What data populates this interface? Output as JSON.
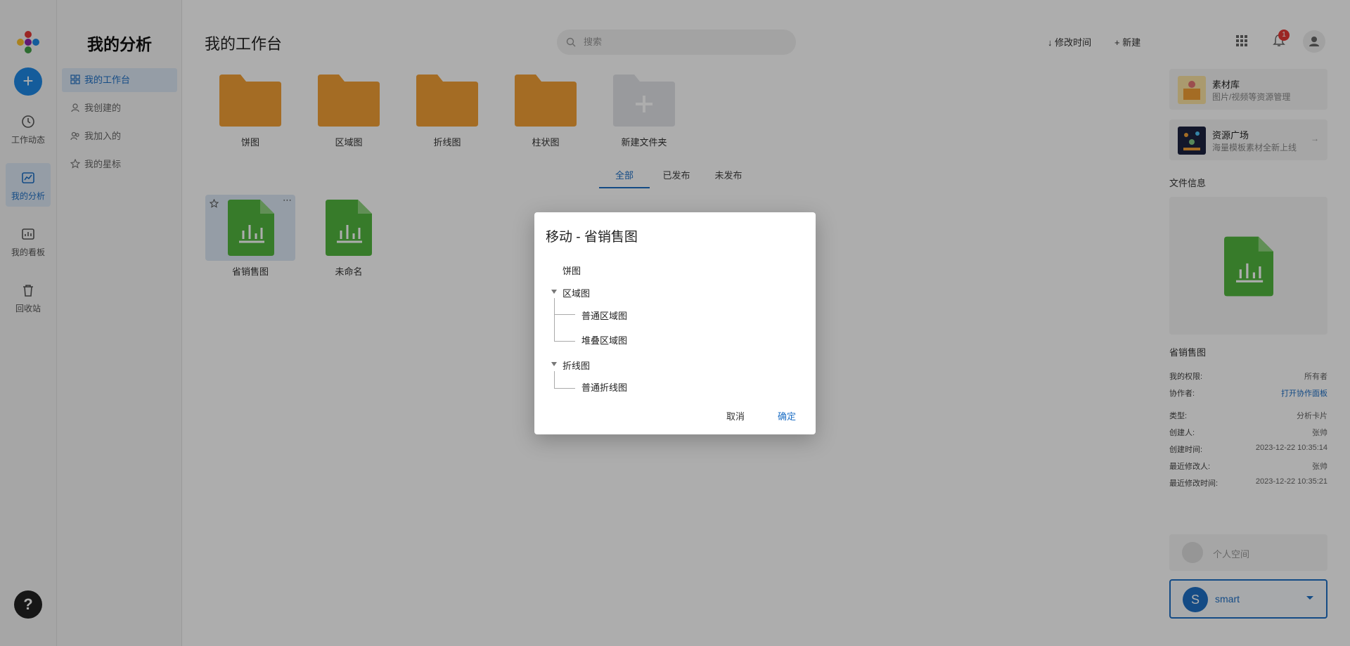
{
  "sidebar": {
    "add_label": "+",
    "items": [
      {
        "label": "工作动态",
        "icon": "clock-icon"
      },
      {
        "label": "我的分析",
        "icon": "analysis-icon"
      },
      {
        "label": "我的看板",
        "icon": "dashboard-icon"
      },
      {
        "label": "回收站",
        "icon": "trash-icon"
      }
    ],
    "help_label": "?"
  },
  "subnav": {
    "title": "我的分析",
    "items": [
      {
        "label": "我的工作台",
        "icon": "grid-icon"
      },
      {
        "label": "我创建的",
        "icon": "user-icon"
      },
      {
        "label": "我加入的",
        "icon": "users-icon"
      },
      {
        "label": "我的星标",
        "icon": "star-icon"
      }
    ]
  },
  "header": {
    "title": "我的工作台",
    "search_placeholder": "搜索",
    "sort_label": "修改时间",
    "new_label": "新建",
    "notification_count": "1"
  },
  "folders": [
    {
      "label": "饼图"
    },
    {
      "label": "区域图"
    },
    {
      "label": "折线图"
    },
    {
      "label": "柱状图"
    },
    {
      "label": "新建文件夹"
    }
  ],
  "tabs": [
    {
      "label": "全部"
    },
    {
      "label": "已发布"
    },
    {
      "label": "未发布"
    }
  ],
  "files": [
    {
      "label": "省销售图"
    },
    {
      "label": "未命名"
    }
  ],
  "right_panel": {
    "library": {
      "title": "素材库",
      "subtitle": "图片/视频等资源管理"
    },
    "plaza": {
      "title": "资源广场",
      "subtitle": "海量模板素材全新上线"
    },
    "file_info_title": "文件信息",
    "file_name": "省销售图",
    "rows": [
      {
        "k": "我的权限:",
        "v": "所有者"
      },
      {
        "k": "协作者:",
        "v": "打开协作面板"
      },
      {
        "k": "类型:",
        "v": "分析卡片"
      },
      {
        "k": "创建人:",
        "v": "张帅"
      },
      {
        "k": "创建时间:",
        "v": "2023-12-22 10:35:14"
      },
      {
        "k": "最近修改人:",
        "v": "张帅"
      },
      {
        "k": "最近修改时间:",
        "v": "2023-12-22 10:35:21"
      }
    ],
    "personal_space": "个人空间",
    "user": {
      "initial": "S",
      "name": "smart"
    }
  },
  "dialog": {
    "title": "移动 - 省销售图",
    "tree": [
      {
        "label": "饼图"
      },
      {
        "label": "区域图",
        "children": [
          {
            "label": "普通区域图"
          },
          {
            "label": "堆叠区域图"
          }
        ]
      },
      {
        "label": "折线图",
        "children": [
          {
            "label": "普通折线图"
          }
        ]
      }
    ],
    "cancel_label": "取消",
    "ok_label": "确定"
  },
  "colors": {
    "accent": "#1e6fc5",
    "folder": "#f2a036",
    "file": "#52b53f",
    "badge": "#e53935"
  }
}
